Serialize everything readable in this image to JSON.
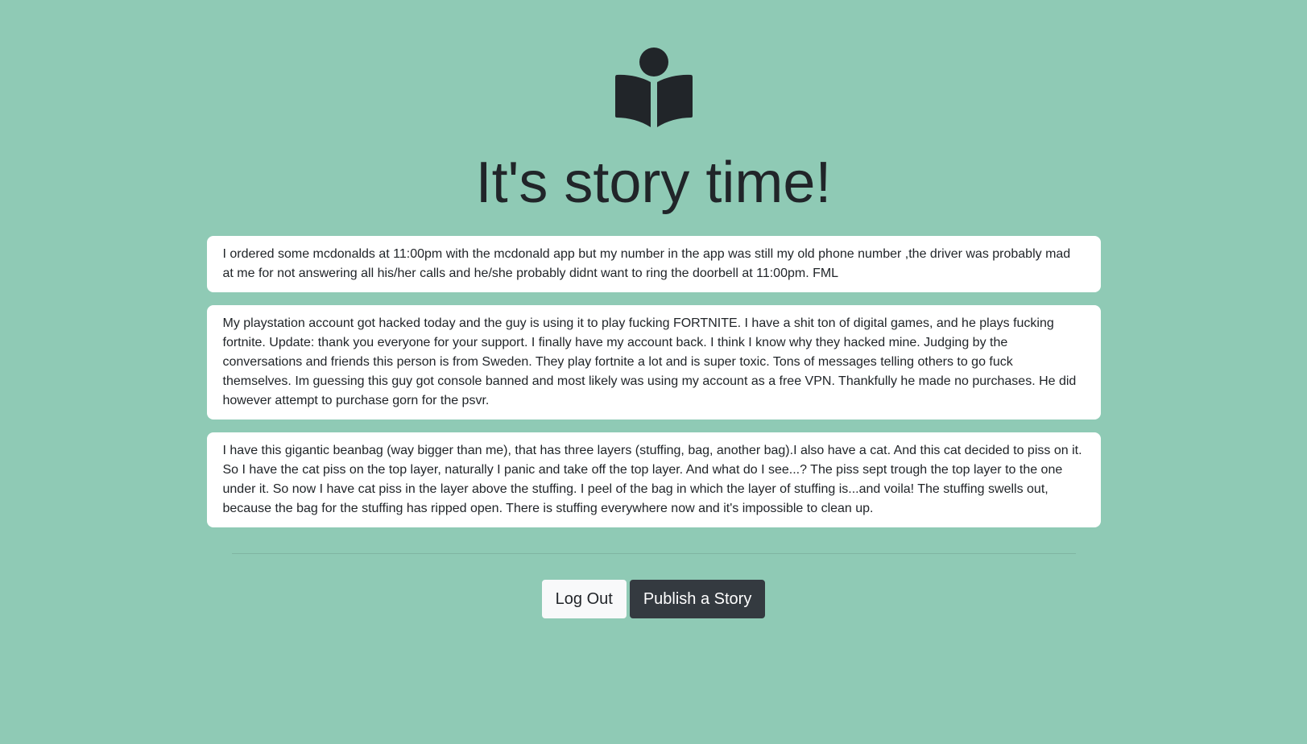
{
  "header": {
    "logo_icon": "book-reader-icon",
    "title": "It's story time!"
  },
  "stories": [
    {
      "text": "I ordered some mcdonalds at 11:00pm with the mcdonald app but my number in the app was still my old phone number ,the driver was probably mad at me for not answering all his/her calls and he/she probably didnt want to ring the doorbell at 11:00pm. FML"
    },
    {
      "text": "My playstation account got hacked today and the guy is using it to play fucking FORTNITE. I have a shit ton of digital games, and he plays fucking fortnite. Update: thank you everyone for your support. I finally have my account back. I think I know why they hacked mine. Judging by the conversations and friends this person is from Sweden. They play fortnite a lot and is super toxic. Tons of messages telling others to go fuck themselves. Im guessing this guy got console banned and most likely was using my account as a free VPN. Thankfully he made no purchases. He did however attempt to purchase gorn for the psvr."
    },
    {
      "text": "I have this gigantic beanbag (way bigger than me), that has three layers (stuffing, bag, another bag).I also have a cat. And this cat decided to piss on it. So I have the cat piss on the top layer, naturally I panic and take off the top layer. And what do I see...? The piss sept trough the top layer to the one under it. So now I have cat piss in the layer above the stuffing. I peel of the bag in which the layer of stuffing is...and voila! The stuffing swells out, because the bag for the stuffing has ripped open. There is stuffing everywhere now and it's impossible to clean up."
    }
  ],
  "actions": {
    "logout_label": "Log Out",
    "publish_label": "Publish a Story"
  },
  "colors": {
    "background": "#8fcab5",
    "text": "#212529",
    "card": "#ffffff",
    "button_light": "#f8f9fa",
    "button_dark": "#343a40"
  }
}
